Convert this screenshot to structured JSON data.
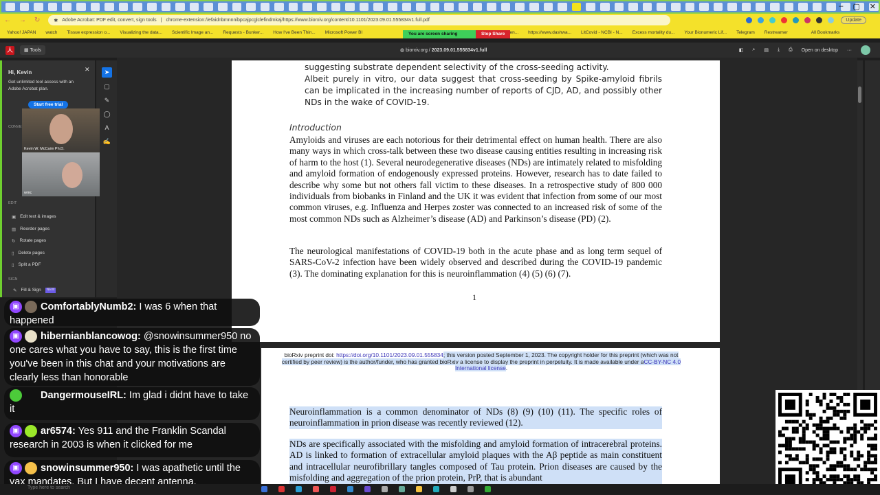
{
  "browser": {
    "tab_count": 62,
    "address_title": "Adobe Acrobat: PDF edit, convert, sign tools",
    "url": "chrome-extension://efaidnbmnnnibpcajpcglclefindmkaj/https://www.biorxiv.org/content/10.1101/2023.09.01.555834v1.full.pdf",
    "update_label": "Update",
    "bookmarks": [
      "Yahoo! JAPAN",
      "watch",
      "Tissue expression o...",
      "Visualizing the data...",
      "Scientific Image an...",
      "Requests - Bunker...",
      "How I've Been Thin...",
      "Microsoft Power BI",
      "COVID-19/Biodefen...",
      "https://www.dashwa...",
      "LitCovid - NCBI - N...",
      "Excess mortality du...",
      "Your Bionumeric Lif...",
      "Telegram",
      "Restreamer",
      "All Bookmarks"
    ],
    "screen_share": {
      "status": "You are screen sharing",
      "stop": "Stop Share"
    }
  },
  "acrobat": {
    "tools_label": "Tools",
    "breadcrumb_site": "biorxiv.org",
    "breadcrumb_sep": "/",
    "breadcrumb_file": "2023.09.01.555834v1.full",
    "open_desktop": "Open on desktop",
    "more": "···"
  },
  "left_panel": {
    "greeting": "Hi, Kevin",
    "promo": "Get unlimited tool access with an Adobe Acrobat plan.",
    "trial_button": "Start free trial",
    "convert_section": "CONVE",
    "edit_section": "EDIT",
    "sign_section": "SIGN",
    "edit_items": [
      "Edit text & images",
      "Reorder pages",
      "Rotate pages",
      "Delete pages",
      "Split a PDF"
    ],
    "sign_item": "Fill & Sign",
    "new_badge": "NEW"
  },
  "video": {
    "participant1": "Kevin W. McCaim Ph.D.",
    "participant2": "wmc"
  },
  "page1": {
    "p0_line": "suggesting substrate dependent selectivity of the cross-seeding activity.",
    "p0_text": "Albeit purely in vitro, our data suggest that cross-seeding by Spike-amyloid fibrils can be implicated in the increasing number of reports of CJD, AD, and possibly other NDs in the wake of COVID-19.",
    "heading": "Introduction",
    "p1": "Amyloids and viruses are each notorious for their detrimental effect on human health. There are also many ways in which cross-talk between these two disease causing entities resulting in increasing risk of harm to the host (1). Several neurodegenerative diseases (NDs) are intimately related to misfolding and amyloid formation of endogenously expressed proteins. However, research has to date failed to describe why some but not others fall victim to these diseases. In a retrospective study of 800 000 individuals from biobanks in Finland and the UK it was evident that infection from some of our most common viruses, e.g. Influenza and Herpes zoster was connected to an increased risk of some of the most common NDs such as Alzheimer’s disease (AD) and Parkinson’s disease (PD) (2).",
    "p2": "The neurological manifestations of COVID-19 both in the acute phase and as long term sequel of SARS-CoV-2 infection have been widely observed and described during the COVID-19 pandemic (3). The dominating explanation for this is neuroinflammation (4) (5) (6) (7).",
    "page_number": "1"
  },
  "page2": {
    "header_prefix": "bioRxiv preprint doi: ",
    "doi": "https://doi.org/10.1101/2023.09.01.555834",
    "header_mid": "; this version posted September 1, 2023. The copyright holder for this preprint (which was not certified by peer review) is the author/funder, who has granted bioRxiv a license to display the preprint in perpetuity. It is made available under a",
    "license": "CC-BY-NC 4.0 International license",
    "p1": "Neuroinflammation is a common denominator of NDs  (8) (9) (10) (11). The specific roles of neuroinflammation in prion disease was recently reviewed (12).",
    "p2": "NDs are specifically associated with the misfolding and amyloid formation of intracerebral proteins.  AD is linked to formation of extracellular amyloid plaques with the Aβ peptide as main constituent and intracellular neurofibrillary tangles composed of Tau protein. Prion diseases are caused by the misfolding and aggregation of the prion protein, PrP, that is abundant"
  },
  "chat": [
    {
      "user": "ComfortablyNumb2:",
      "text": "I was 6 when that happened",
      "platform": "twitch"
    },
    {
      "user": "hibernianblancowog:",
      "text": "@snowinsummer950 no one cares what you have to say, this is the first time you've been in this chat and your motivations are clearly less than honorable",
      "platform": "twitch"
    },
    {
      "user": "DangermouseIRL:",
      "text": "Im glad i didnt have to take it",
      "platform": "rumble"
    },
    {
      "user": "ar6574:",
      "text": "Yes 911 and the Franklin Scandal research in 2003 is when it clicked for me",
      "platform": "twitch"
    },
    {
      "user": "snowinsummer950:",
      "text": "I was apathetic until the vax mandates. But I have decent antenna.",
      "platform": "twitch"
    }
  ],
  "taskbar": {
    "search_placeholder": "Type here to search"
  },
  "colors": {
    "accent": "#1473e6",
    "bookmark_bar": "#f4e12a",
    "twitch": "#9147ff",
    "rumble": "#4ccb3a"
  }
}
